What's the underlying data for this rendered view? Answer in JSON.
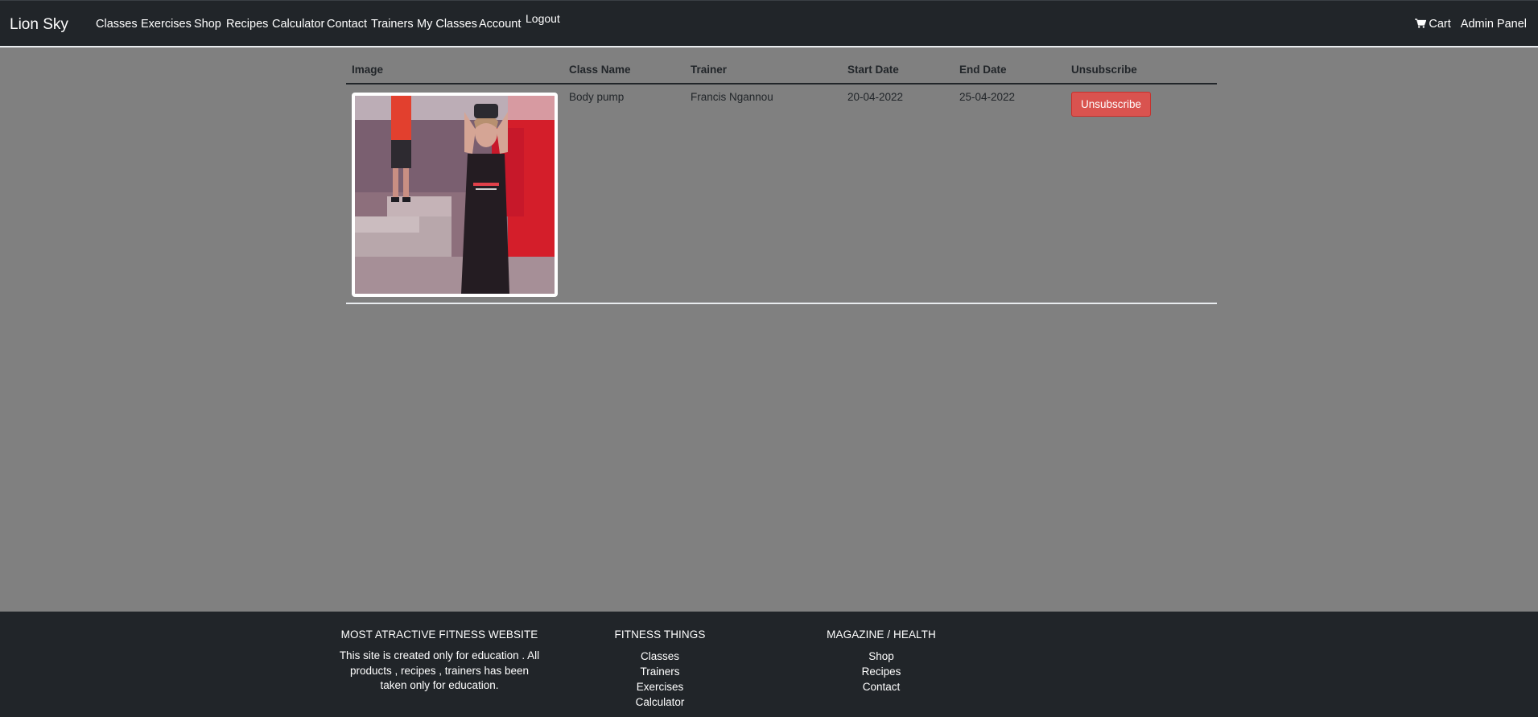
{
  "navbar": {
    "brand": "Lion Sky",
    "links": [
      "Classes",
      "Exercises",
      "Shop",
      "Recipes",
      "Calculator",
      "Contact",
      "Trainers",
      "My Classes",
      "Account"
    ],
    "logout": "Logout",
    "cart": "Cart",
    "admin": "Admin Panel",
    "cart_icon": "shopping-cart-icon"
  },
  "table": {
    "headers": [
      "Image",
      "Class Name",
      "Trainer",
      "Start Date",
      "End Date",
      "Unsubscribe"
    ],
    "rows": [
      {
        "class_name": "Body pump",
        "trainer": "Francis Ngannou",
        "start_date": "20-04-2022",
        "end_date": "25-04-2022",
        "action": "Unsubscribe"
      }
    ]
  },
  "footer": {
    "col1": {
      "title": "MOST ATRACTIVE FITNESS WEBSITE",
      "text": "This site is created only for education . All products , recipes , trainers has been taken only for education."
    },
    "col2": {
      "title": "FITNESS THINGS",
      "links": [
        "Classes",
        "Trainers",
        "Exercises",
        "Calculator"
      ]
    },
    "col3": {
      "title": "MAGAZINE / HEALTH",
      "links": [
        "Shop",
        "Recipes",
        "Contact"
      ]
    }
  },
  "colors": {
    "navbar_bg": "#212529",
    "page_bg": "#808080",
    "danger": "#d9534f"
  }
}
